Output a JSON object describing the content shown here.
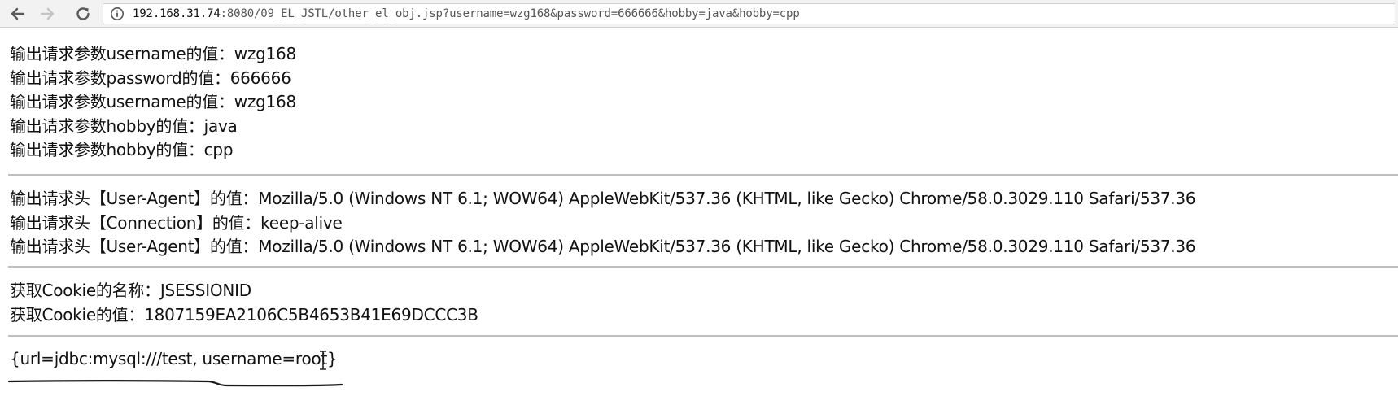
{
  "browser": {
    "url_host": "192.168.31.74",
    "url_rest": ":8080/09_EL_JSTL/other_el_obj.jsp?username=wzg168&password=666666&hobby=java&hobby=cpp"
  },
  "params": [
    {
      "text": "输出请求参数username的值：wzg168"
    },
    {
      "text": "输出请求参数password的值：666666"
    },
    {
      "text": "输出请求参数username的值：wzg168"
    },
    {
      "text": "输出请求参数hobby的值：java"
    },
    {
      "text": "输出请求参数hobby的值：cpp"
    }
  ],
  "headers": [
    {
      "text": "输出请求头【User-Agent】的值：Mozilla/5.0 (Windows NT 6.1; WOW64) AppleWebKit/537.36 (KHTML, like Gecko) Chrome/58.0.3029.110 Safari/537.36"
    },
    {
      "text": "输出请求头【Connection】的值：keep-alive"
    },
    {
      "text": "输出请求头【User-Agent】的值：Mozilla/5.0 (Windows NT 6.1; WOW64) AppleWebKit/537.36 (KHTML, like Gecko) Chrome/58.0.3029.110 Safari/537.36"
    }
  ],
  "cookie": {
    "name_line": "获取Cookie的名称：JSESSIONID",
    "value_line": "获取Cookie的值：1807159EA2106C5B4653B41E69DCCC3B"
  },
  "map_output": "{url=jdbc:mysql:///test, username=root}",
  "icons": {
    "back": "arrow-left-icon",
    "forward": "arrow-right-icon",
    "reload": "reload-icon",
    "info": "info-circle-icon"
  }
}
